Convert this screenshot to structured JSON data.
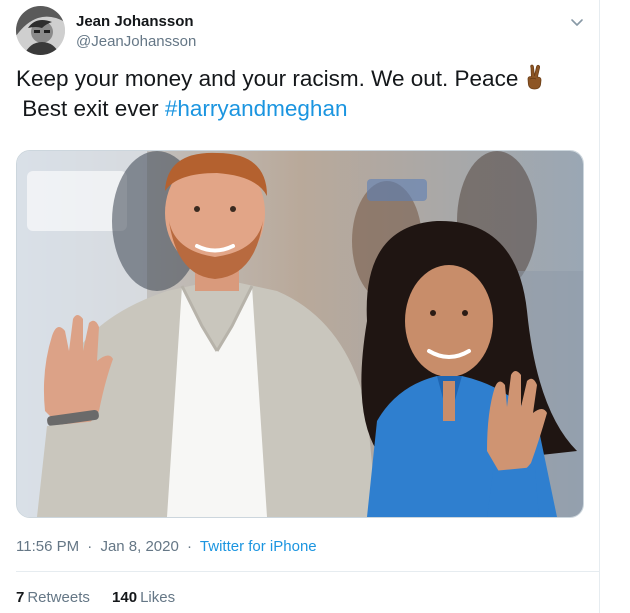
{
  "author": {
    "display_name": "Jean Johansson",
    "handle": "@JeanJohansson",
    "avatar_icon": "avatar-photo"
  },
  "menu": {
    "icon": "chevron-down-icon"
  },
  "tweet": {
    "text_line1": "Keep your money and your racism. We out. Peace",
    "emoji_icon": "victory-hand-icon",
    "text_line2_prefix": "Best exit ever",
    "hashtag": "#harryandmeghan"
  },
  "media": {
    "type": "photo",
    "icon": "photo-couple-waving"
  },
  "meta": {
    "time": "11:56 PM",
    "separator": "·",
    "date": "Jan 8, 2020",
    "source": "Twitter for iPhone"
  },
  "stats": {
    "retweets_count": "7",
    "retweets_label": "Retweets",
    "likes_count": "140",
    "likes_label": "Likes"
  },
  "colors": {
    "link": "#1b95e0",
    "primary_text": "#14171a",
    "secondary_text": "#657786",
    "border": "#e6ecf0"
  }
}
